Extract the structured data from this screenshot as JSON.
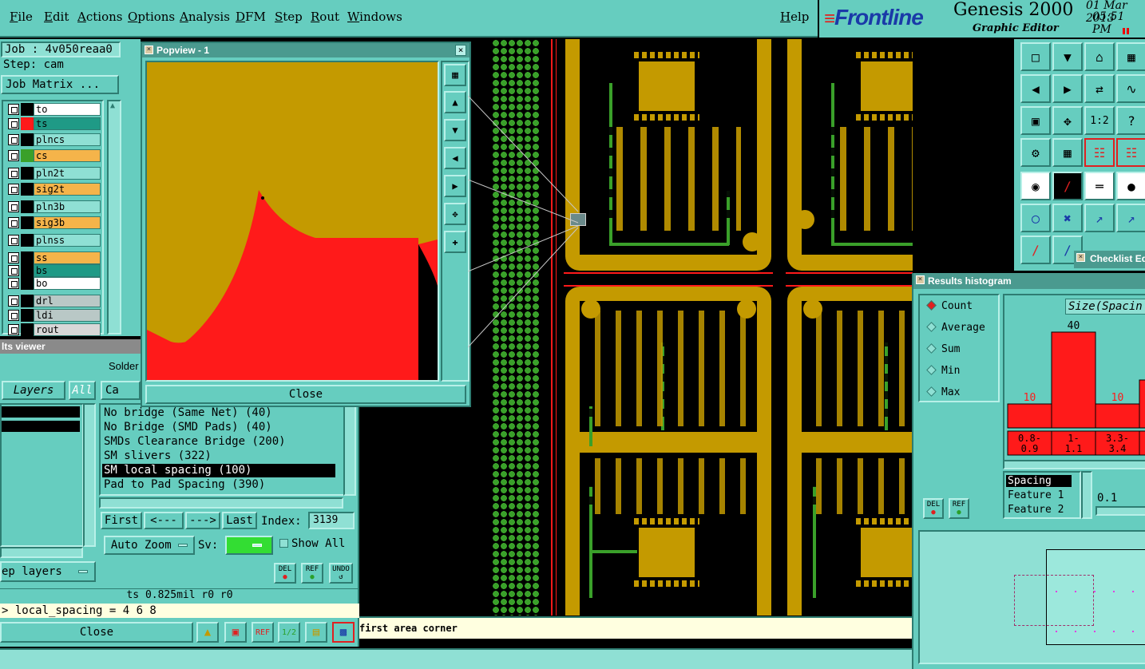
{
  "menubar": {
    "items": [
      "File",
      "Edit",
      "Actions",
      "Options",
      "Analysis",
      "DFM",
      "Step",
      "Rout",
      "Windows"
    ],
    "help": "Help"
  },
  "brand": {
    "logo": "Frontline",
    "product": "Genesis 2000",
    "subtitle": "Graphic Editor",
    "date": "01 Mar 2013",
    "time": "05:51 PM"
  },
  "job": {
    "job_label": "Job : 4v050reaa0",
    "step_label": "Step: cam",
    "matrix_button": "Job Matrix ..."
  },
  "layers": [
    {
      "name": "to",
      "swatch": "#000000",
      "bg": "#ffffff"
    },
    {
      "name": "ts",
      "swatch": "#ff1a1a",
      "bg": "#1f9a86"
    },
    {
      "name": "plncs",
      "swatch": "#000000",
      "bg": "#8fe0d4"
    },
    {
      "name": "cs",
      "swatch": "#3aa02a",
      "bg": "#f5b44a"
    },
    {
      "name": "pln2t",
      "swatch": "#000000",
      "bg": "#8fe0d4"
    },
    {
      "name": "sig2t",
      "swatch": "#000000",
      "bg": "#f5b44a"
    },
    {
      "name": "pln3b",
      "swatch": "#000000",
      "bg": "#8fe0d4"
    },
    {
      "name": "sig3b",
      "swatch": "#000000",
      "bg": "#f5b44a"
    },
    {
      "name": "plnss",
      "swatch": "#000000",
      "bg": "#8fe0d4"
    },
    {
      "name": "ss",
      "swatch": "#000000",
      "bg": "#f5b44a"
    },
    {
      "name": "bs",
      "swatch": "#000000",
      "bg": "#1f9a86"
    },
    {
      "name": "bo",
      "swatch": "#000000",
      "bg": "#ffffff"
    },
    {
      "name": "drl",
      "swatch": "#000000",
      "bg": "#b9c8c6"
    },
    {
      "name": "ldi",
      "swatch": "#000000",
      "bg": "#b9c8c6"
    },
    {
      "name": "rout",
      "swatch": "#000000",
      "bg": "#d8d8d8"
    }
  ],
  "popview": {
    "title": "Popview - 1",
    "close": "Close"
  },
  "results_viewer": {
    "title": "lts viewer",
    "header": "Solder",
    "tab_layers": "Layers",
    "tab_all": "All",
    "category_partial": "Ca",
    "list": [
      "No bridge (Same Net) (40)",
      "No Bridge (SMD Pads) (40)",
      "SMDs Clearance Bridge (200)",
      "SM slivers (322)",
      "SM local spacing (100)",
      "Pad to Pad Spacing (390)"
    ],
    "selected_index": 4,
    "first": "First",
    "prev": "<---",
    "next": "--->",
    "last": "Last",
    "index_label": "Index:",
    "index_value": "3139",
    "auto_zoom": "Auto Zoom",
    "sv_label": "Sv:",
    "show_all": "Show All",
    "step_layers": "ep layers",
    "del": "DEL",
    "ref": "REF",
    "undo": "UNDO",
    "status": "ts 0.825mil  r0  r0",
    "command": "> local_spacing = 4 6 8",
    "close": "Close"
  },
  "prompt": "first area corner",
  "histogram": {
    "title": "Results histogram",
    "modes": [
      "Count",
      "Average",
      "Sum",
      "Min",
      "Max"
    ],
    "selected_mode": "Count",
    "field_title": "Size(Spacin",
    "del": "DEL",
    "ref": "REF",
    "list": [
      "Spacing",
      "Feature 1",
      "Feature 2"
    ],
    "value": "0.1"
  },
  "checklist": {
    "title": "Checklist Edi"
  },
  "chart_data": {
    "type": "bar",
    "categories": [
      "0.8-0.9",
      "1-1.1",
      "3.3-3.4",
      ""
    ],
    "values": [
      10,
      40,
      10,
      20
    ],
    "labels": [
      "10",
      "40",
      "10",
      ""
    ],
    "title": "Size(Spacin",
    "colors": {
      "bar": "#ff1a1a",
      "label_small": "#ff1a1a",
      "label_big": "#000000"
    }
  }
}
